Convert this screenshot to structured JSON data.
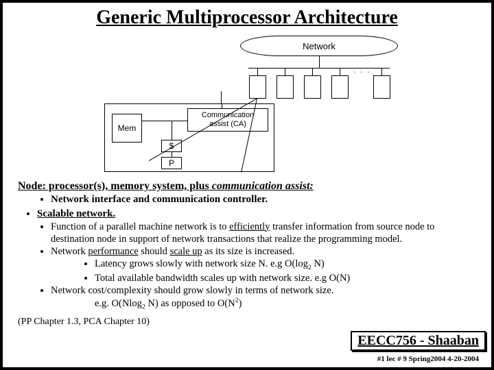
{
  "title": "Generic Multiprocessor Architecture",
  "diagram": {
    "network": "Network",
    "mem": "Mem",
    "ca": "Communication\nassist (CA)",
    "cache": "$",
    "proc": "P"
  },
  "node_line_prefix": "Node: processor(s), memory system, plus ",
  "node_line_assist": "communication assist:",
  "node_sub": "Network interface and communication controller.",
  "scalable": "Scalable network.",
  "b1_pre": "Function of a parallel machine network is to ",
  "b1_uline": "efficiently",
  "b1_post": " transfer information from source node to destination node in support of network transactions that realize the programming model.",
  "b2_pre": "Network ",
  "b2_u1": "performance",
  "b2_mid": " should ",
  "b2_u2": "scale up",
  "b2_post": " as its size is increased.",
  "b2a_pre": "Latency grows slowly with network size N.  e.g O(log",
  "b2a_sub": "2",
  "b2a_post": " N)",
  "b2b": "Total available bandwidth scales up with network size.  e.g O(N)",
  "b3": "Network cost/complexity should grow slowly in terms of network size.",
  "b3eg_pre": "e.g. O(Nlog",
  "b3eg_sub": "2",
  "b3eg_mid": " N)  as opposed to O(N",
  "b3eg_sup": "2",
  "b3eg_post": ")",
  "refs": "(PP Chapter 1.3,  PCA Chapter 10)",
  "course": "EECC756 - Shaaban",
  "footer": "#1  lec # 9     Spring2004   4-20-2004"
}
